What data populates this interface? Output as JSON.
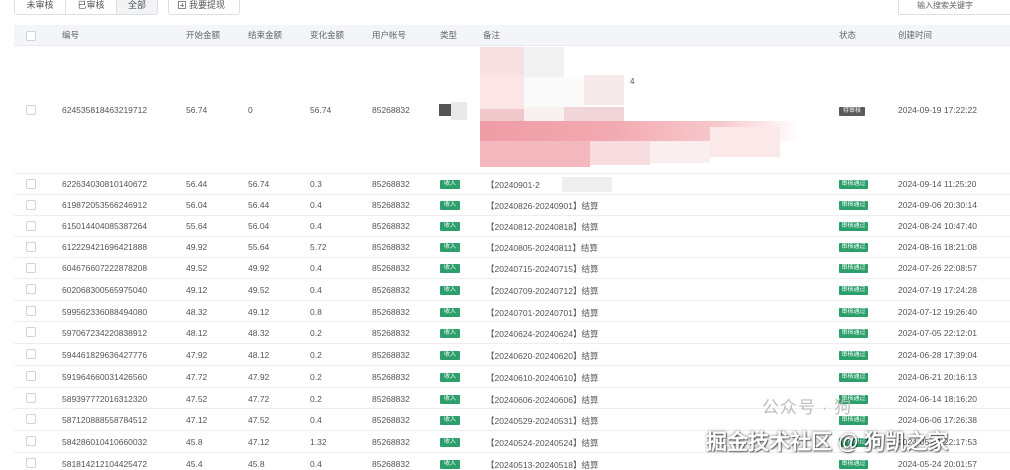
{
  "filters": {
    "tabs": [
      {
        "label": "未审核"
      },
      {
        "label": "已审核"
      },
      {
        "label": "全部"
      }
    ],
    "withdraw_label": "我要提现",
    "search_placeholder": "输入搜索关键字"
  },
  "table": {
    "columns": [
      "编号",
      "开始金额",
      "结束金额",
      "变化金额",
      "用户帐号",
      "类型",
      "备注",
      "状态",
      "创建时间"
    ],
    "first_row": {
      "id": "624535818463219712",
      "start": "56.74",
      "end": "0",
      "change": "56.74",
      "account": "85268832",
      "note_visible": "4",
      "status": "待审核",
      "created": "2024-09-19 17:22:22"
    },
    "rows": [
      {
        "id": "622634030810140672",
        "start": "56.44",
        "end": "56.74",
        "change": "0.3",
        "account": "85268832",
        "type": "收入",
        "note": "【20240901-2",
        "status": "审核通过",
        "created": "2024-09-14 11:25:20"
      },
      {
        "id": "619872053566246912",
        "start": "56.04",
        "end": "56.44",
        "change": "0.4",
        "account": "85268832",
        "type": "收入",
        "note": "【20240826-20240901】结算",
        "status": "审核通过",
        "created": "2024-09-06 20:30:14"
      },
      {
        "id": "615014404085387264",
        "start": "55.64",
        "end": "56.04",
        "change": "0.4",
        "account": "85268832",
        "type": "收入",
        "note": "【20240812-20240818】结算",
        "status": "审核通过",
        "created": "2024-08-24 10:47:40"
      },
      {
        "id": "612229421696421888",
        "start": "49.92",
        "end": "55.64",
        "change": "5.72",
        "account": "85268832",
        "type": "收入",
        "note": "【20240805-20240811】结算",
        "status": "审核通过",
        "created": "2024-08-16 18:21:08"
      },
      {
        "id": "604676607222878208",
        "start": "49.52",
        "end": "49.92",
        "change": "0.4",
        "account": "85268832",
        "type": "收入",
        "note": "【20240715-20240715】结算",
        "status": "审核通过",
        "created": "2024-07-26 22:08:57"
      },
      {
        "id": "602068300565975040",
        "start": "49.12",
        "end": "49.52",
        "change": "0.4",
        "account": "85268832",
        "type": "收入",
        "note": "【20240709-20240712】结算",
        "status": "审核通过",
        "created": "2024-07-19 17:24:28"
      },
      {
        "id": "599562336088494080",
        "start": "48.32",
        "end": "49.12",
        "change": "0.8",
        "account": "85268832",
        "type": "收入",
        "note": "【20240701-20240701】结算",
        "status": "审核通过",
        "created": "2024-07-12 19:26:40"
      },
      {
        "id": "597067234220838912",
        "start": "48.12",
        "end": "48.32",
        "change": "0.2",
        "account": "85268832",
        "type": "收入",
        "note": "【20240624-20240624】结算",
        "status": "审核通过",
        "created": "2024-07-05 22:12:01"
      },
      {
        "id": "594461829636427776",
        "start": "47.92",
        "end": "48.12",
        "change": "0.2",
        "account": "85268832",
        "type": "收入",
        "note": "【20240620-20240620】结算",
        "status": "审核通过",
        "created": "2024-06-28 17:39:04"
      },
      {
        "id": "591964660031426560",
        "start": "47.72",
        "end": "47.92",
        "change": "0.2",
        "account": "85268832",
        "type": "收入",
        "note": "【20240610-20240610】结算",
        "status": "审核通过",
        "created": "2024-06-21 20:16:13"
      },
      {
        "id": "589397772016312320",
        "start": "47.52",
        "end": "47.72",
        "change": "0.2",
        "account": "85268832",
        "type": "收入",
        "note": "【20240606-20240606】结算",
        "status": "审核通过",
        "created": "2024-06-14 18:16:20"
      },
      {
        "id": "587120888558784512",
        "start": "47.12",
        "end": "47.52",
        "change": "0.4",
        "account": "85268832",
        "type": "收入",
        "note": "【20240529-20240531】结算",
        "status": "审核通过",
        "created": "2024-06-06 17:26:38"
      },
      {
        "id": "584286010410660032",
        "start": "45.8",
        "end": "47.12",
        "change": "1.32",
        "account": "85268832",
        "type": "收入",
        "note": "【20240524-20240524】结算",
        "status": "审核通过",
        "created": "2024-05-31 22:17:53"
      },
      {
        "id": "581814212104425472",
        "start": "45.4",
        "end": "45.8",
        "change": "0.4",
        "account": "85268832",
        "type": "收入",
        "note": "【20240513-20240518】结算",
        "status": "审核通过",
        "created": "2024-05-24 20:01:57"
      }
    ]
  },
  "watermark": {
    "faint": "公众号 · 狗",
    "main": "掘金技术社区 @ 狗凯之家"
  }
}
